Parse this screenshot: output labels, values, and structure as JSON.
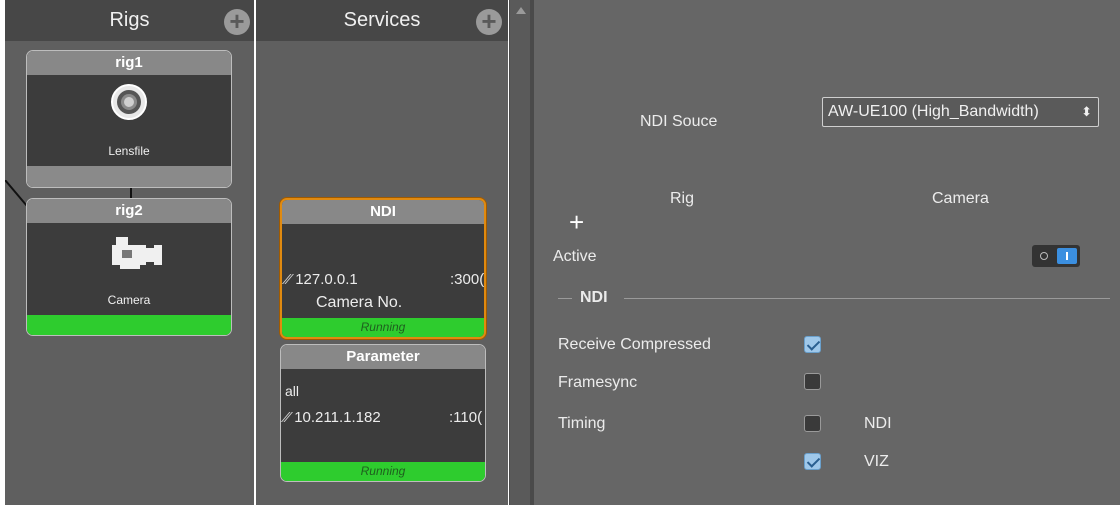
{
  "rigs_panel": {
    "title": "Rigs",
    "add_icon": "plus-circle-icon",
    "nodes": [
      {
        "title": "rig1",
        "icon": "lens-icon",
        "label": "Lensfile"
      },
      {
        "title": "rig2",
        "icon": "camera-icon",
        "label": "Camera"
      }
    ]
  },
  "services_panel": {
    "title": "Services",
    "add_icon": "plus-circle-icon",
    "nodes": [
      {
        "title": "NDI",
        "ip": "127.0.0.1",
        "port": ":300(",
        "line2": "Camera No.",
        "status": "Running",
        "link_icon": "link-icon"
      },
      {
        "title": "Parameter",
        "line1": "all",
        "ip": "10.211.1.182",
        "port": ":110(",
        "status": "Running",
        "link_icon": "link-icon"
      }
    ]
  },
  "detail": {
    "ndi_source_label": "NDI Souce",
    "ndi_source_value": "AW-UE100 (High_Bandwidth)",
    "rig_header": "Rig",
    "camera_header": "Camera",
    "add_label": "+",
    "active_label": "Active",
    "section_title": "NDI",
    "receive_compressed_label": "Receive Compressed",
    "framesync_label": "Framesync",
    "timing_label": "Timing",
    "timing_ndi_label": "NDI",
    "timing_viz_label": "VIZ",
    "values": {
      "receive_compressed": true,
      "framesync": false,
      "timing_ndi": false,
      "timing_viz": true,
      "active": true
    }
  },
  "colors": {
    "running_green": "#2ecc2e",
    "selected_border": "#e08a10",
    "toggle_on": "#3b8fe0"
  }
}
